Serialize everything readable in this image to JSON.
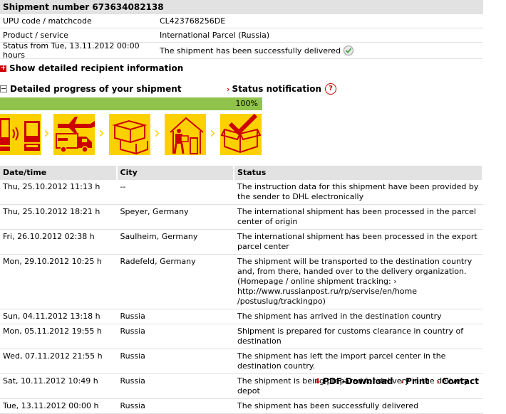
{
  "summary": {
    "header": "Shipment number 673634082138",
    "rows": [
      {
        "label": "UPU code / matchcode",
        "value": "CL423768256DE"
      },
      {
        "label": "Product / service",
        "value": "International Parcel (Russia)"
      },
      {
        "label": "Status from Tue, 13.11.2012 00:00 hours",
        "value": "The shipment has been successfully delivered"
      }
    ]
  },
  "recipient_toggle": "Show detailed recipient information",
  "progress_toggle": "Detailed progress of your shipment",
  "status_notification": "Status notification",
  "progress": {
    "percent_label": "100%",
    "fraction": 1.0
  },
  "steps": [
    {
      "icon": "data-transfer-icon"
    },
    {
      "icon": "truck-plane-icon"
    },
    {
      "icon": "parcels-icon"
    },
    {
      "icon": "courier-house-icon"
    },
    {
      "icon": "delivered-box-icon"
    }
  ],
  "history": {
    "columns": [
      "Date/time",
      "City",
      "Status"
    ],
    "rows": [
      {
        "date": "Thu, 25.10.2012 11:13 h",
        "city": "--",
        "status": "The instruction data for this shipment have been provided by the sender to DHL electronically"
      },
      {
        "date": "Thu, 25.10.2012 18:21 h",
        "city": "Speyer, Germany",
        "status": "The international shipment has been processed in the parcel center of origin"
      },
      {
        "date": "Fri, 26.10.2012 02:38 h",
        "city": "Saulheim, Germany",
        "status": "The international shipment has been processed in the export parcel center"
      },
      {
        "date": "Mon, 29.10.2012 10:25 h",
        "city": "Radefeld, Germany",
        "status": "The shipment will be transported to the destination country and, from there, handed over to the delivery organization. (Homepage / online shipment tracking: › http://www.russianpost.ru/rp/servise/en/home /postuslug/trackingpo)"
      },
      {
        "date": "Sun, 04.11.2012 13:18 h",
        "city": "Russia",
        "status": "The shipment has arrived in the destination country"
      },
      {
        "date": "Mon, 05.11.2012 19:55 h",
        "city": "Russia",
        "status": "Shipment is prepared for customs clearance in country of destination"
      },
      {
        "date": "Wed, 07.11.2012 21:55 h",
        "city": "Russia",
        "status": "The shipment has left the import parcel center in the destination country."
      },
      {
        "date": "Sat, 10.11.2012 10:49 h",
        "city": "Russia",
        "status": "The shipment is being prepared for delivery in the delivery depot"
      },
      {
        "date": "Tue, 13.11.2012 00:00 h",
        "city": "Russia",
        "status": "The shipment has been successfully delivered"
      }
    ]
  },
  "footer": {
    "pdf": "PDF-Download",
    "print": "Print",
    "contact": "Contact"
  },
  "colors": {
    "yellow": "#fdd100",
    "red": "#cc0000",
    "green": "#8fc34b",
    "header_gray": "#e2e2e2"
  }
}
